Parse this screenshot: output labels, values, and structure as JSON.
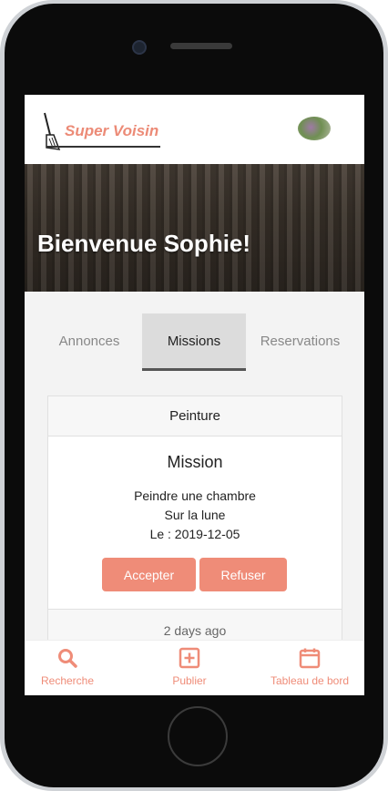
{
  "app": {
    "logo_text": "Super Voisin"
  },
  "hero": {
    "title": "Bienvenue Sophie!"
  },
  "tabs": [
    {
      "label": "Annonces",
      "active": false
    },
    {
      "label": "Missions",
      "active": true
    },
    {
      "label": "Reservations",
      "active": false
    }
  ],
  "card": {
    "header": "Peinture",
    "title": "Mission",
    "description": "Peindre une chambre",
    "location": "Sur la lune",
    "date": "Le : 2019-12-05",
    "accept_label": "Accepter",
    "refuse_label": "Refuser",
    "footer": "2 days ago"
  },
  "bottom_nav": [
    {
      "label": "Recherche",
      "icon": "search-icon"
    },
    {
      "label": "Publier",
      "icon": "plus-square-icon"
    },
    {
      "label": "Tableau de bord",
      "icon": "calendar-icon"
    }
  ],
  "colors": {
    "accent": "#ef8c78",
    "tab_active_bg": "#dcdcdc"
  }
}
